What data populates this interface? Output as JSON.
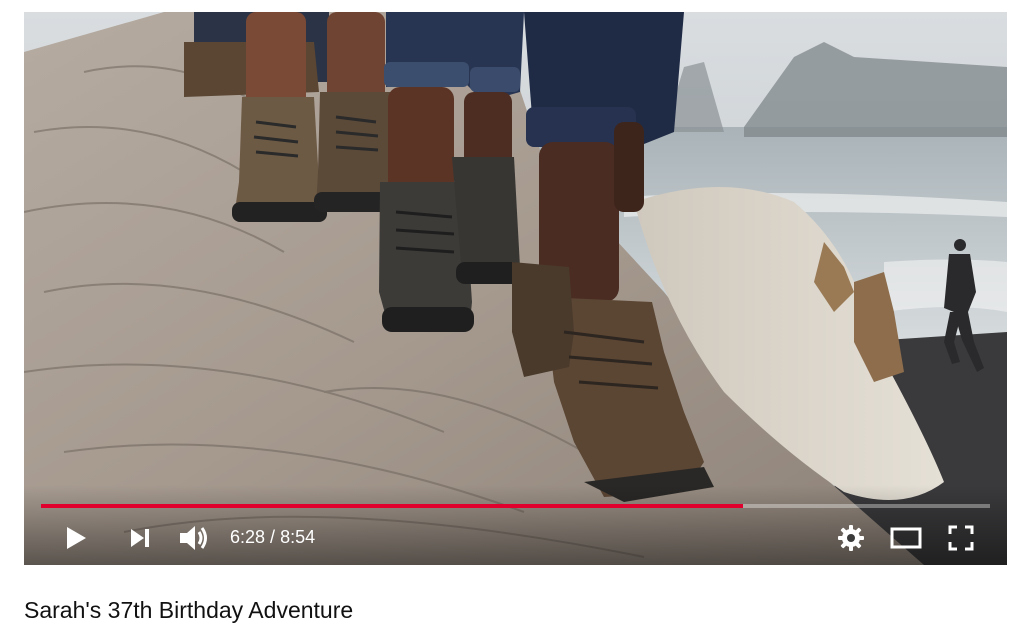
{
  "player": {
    "progress_fraction": 0.74,
    "current_time": "6:28",
    "separator": " / ",
    "duration": "8:54",
    "accent_color": "#e1002d",
    "controls": {
      "play": "play-icon",
      "next": "skip-next-icon",
      "volume": "volume-icon",
      "settings": "gear-icon",
      "theater": "theater-mode-icon",
      "fullscreen": "fullscreen-icon"
    }
  },
  "video": {
    "title": "Sarah's 37th Birthday Adventure"
  }
}
